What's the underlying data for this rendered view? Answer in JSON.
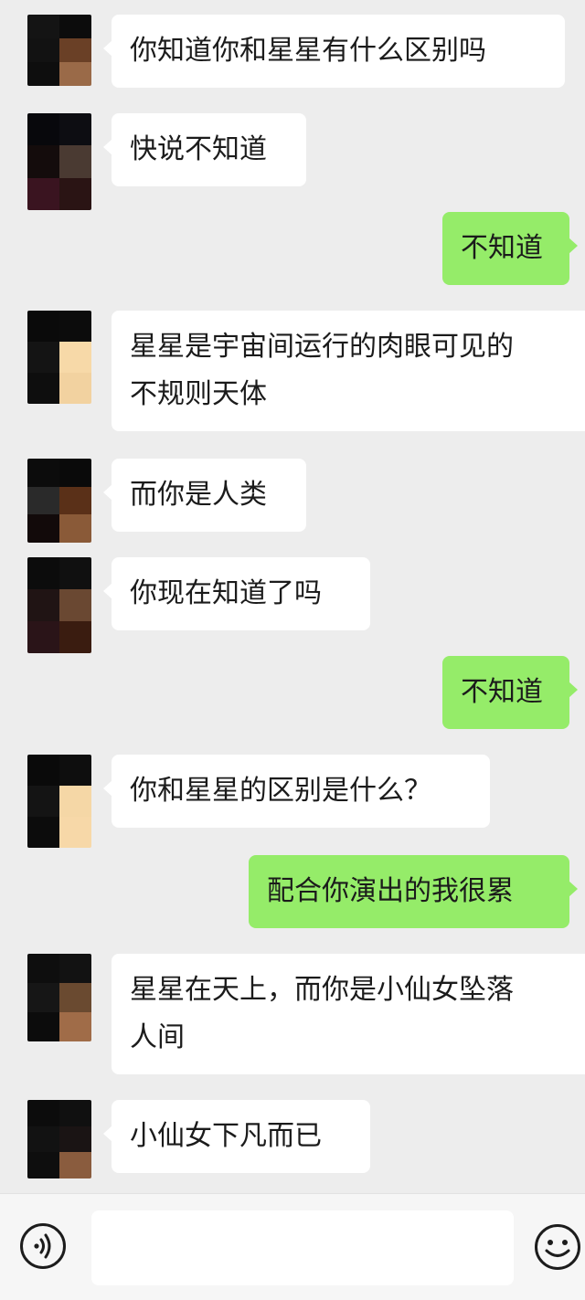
{
  "messages": [
    {
      "side": "in",
      "lines": [
        "你知道你和星星有什么区别吗"
      ]
    },
    {
      "side": "in",
      "lines": [
        "快说不知道"
      ]
    },
    {
      "side": "out",
      "lines": [
        "不知道"
      ]
    },
    {
      "side": "in",
      "lines": [
        "星星是宇宙间运行的肉眼可见的",
        "不规则天体"
      ]
    },
    {
      "side": "in",
      "lines": [
        "而你是人类"
      ]
    },
    {
      "side": "in",
      "lines": [
        "你现在知道了吗"
      ]
    },
    {
      "side": "out",
      "lines": [
        "不知道"
      ]
    },
    {
      "side": "in",
      "lines": [
        "你和星星的区别是什么？"
      ]
    },
    {
      "side": "out",
      "lines": [
        "配合你演出的我很累"
      ]
    },
    {
      "side": "in",
      "lines": [
        "星星在天上，而你是小仙女坠落",
        "人间"
      ]
    },
    {
      "side": "in",
      "lines": [
        "小仙女下凡而已"
      ]
    }
  ],
  "colors": {
    "background": "#ededed",
    "incoming_bubble": "#ffffff",
    "outgoing_bubble": "#95ec69",
    "toolbar": "#f6f6f6"
  },
  "icons": {
    "voice": "voice-icon",
    "emoji": "emoji-icon"
  }
}
